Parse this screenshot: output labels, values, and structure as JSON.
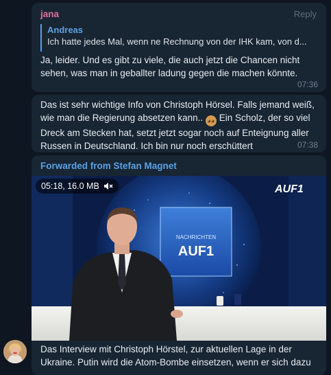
{
  "messages": [
    {
      "sender": "jana",
      "action": "Reply",
      "reply_to": {
        "author": "Andreas",
        "text": "Ich hatte jedes Mal, wenn ne Rechnung von der IHK kam, von d..."
      },
      "text": "Ja, leider. Und es gibt zu viele, die auch jetzt die Chancen nicht sehen, was man in geballter ladung gegen die machen könnte.",
      "time": "07:36"
    },
    {
      "text_before_emoji": "Das ist sehr wichtige Info von Christoph Hörsel. Falls jemand weiß, wie man die Regierung absetzen kann..",
      "emoji": "see-no-evil-monkey",
      "text_after_emoji": "Ein Scholz, der so viel Dreck am Stecken hat, setzt jetzt sogar noch auf Enteignung aller Russen in Deutschland. Ich bin nur noch erschüttert",
      "time": "07:38"
    },
    {
      "forwarded_from": "Forwarded from Stefan Magnet",
      "video": {
        "info": "05:18, 16.0 MB",
        "muted_icon": "speaker-muted-icon",
        "logo_top": "AUF1",
        "screen_small": "NACHRICHTEN",
        "screen_big": "AUF1"
      },
      "caption": "Das Interview mit Christoph Hörstel, zur aktuellen Lage in der Ukraine. Putin wird die Atom-Bombe einsetzen, wenn er sich dazu"
    }
  ],
  "colors": {
    "background": "#0e1621",
    "bubble": "#182533",
    "sender_name": "#e56f9e",
    "accent_blue": "#5aa2e6",
    "timestamp": "#6d7f8f"
  }
}
